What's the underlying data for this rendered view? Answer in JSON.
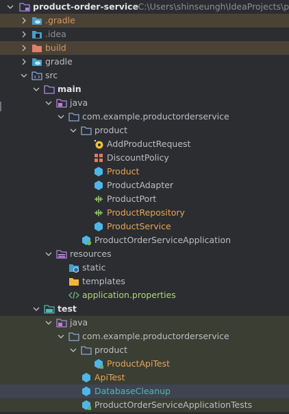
{
  "project": {
    "name": "product-order-service",
    "path": "- C:\\Users\\shinseungh\\IdeaProjects\\product"
  },
  "tree": {
    "gradle_hidden": ".gradle",
    "idea": ".idea",
    "build": "build",
    "gradle": "gradle",
    "src": "src",
    "main": "main",
    "main_java": "java",
    "main_pkg": "com.example.productorderservice",
    "main_product": "product",
    "main_files": [
      "AddProductRequest",
      "DiscountPolicy",
      "Product",
      "ProductAdapter",
      "ProductPort",
      "ProductRepository",
      "ProductService"
    ],
    "main_app": "ProductOrderServiceApplication",
    "resources": "resources",
    "static": "static",
    "templates": "templates",
    "app_props": "application.properties",
    "test": "test",
    "test_java": "java",
    "test_pkg": "com.example.productorderservice",
    "test_product": "product",
    "test_files": [
      "ProductApiTest",
      "ApiTest",
      "DatabaseCleanup",
      "ProductOrderServiceApplicationTests"
    ]
  },
  "colors": {
    "background": "#2b2d30",
    "excluded_row": "#4b4236",
    "test_row": "#3a3e33",
    "selected_row": "#3f4451",
    "orange_text": "#d5985b",
    "green_text": "#6aab73",
    "teal_text": "#56b6b0"
  }
}
